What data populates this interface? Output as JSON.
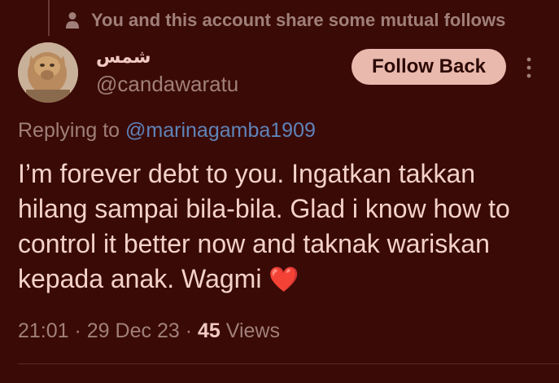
{
  "context": {
    "mutual_text": "You and this account share some mutual follows"
  },
  "author": {
    "display_name": "شمس",
    "handle": "@candawaratu"
  },
  "actions": {
    "follow_label": "Follow Back"
  },
  "reply": {
    "prefix": "Replying to ",
    "mention": "@marinagamba1909"
  },
  "tweet": {
    "text": "I’m forever debt to you. Ingatkan takkan hilang sampai bila-bila. Glad i know how to control it better now and taknak wariskan kepada anak. Wagmi",
    "emoji": "❤️"
  },
  "meta": {
    "time": "21:01",
    "separator": " · ",
    "date": "29 Dec 23",
    "views_count": "45",
    "views_label": " Views"
  },
  "colors": {
    "background": "#3a0a06",
    "accent_link": "#5f83b9",
    "button_bg": "#e9b9ae"
  }
}
